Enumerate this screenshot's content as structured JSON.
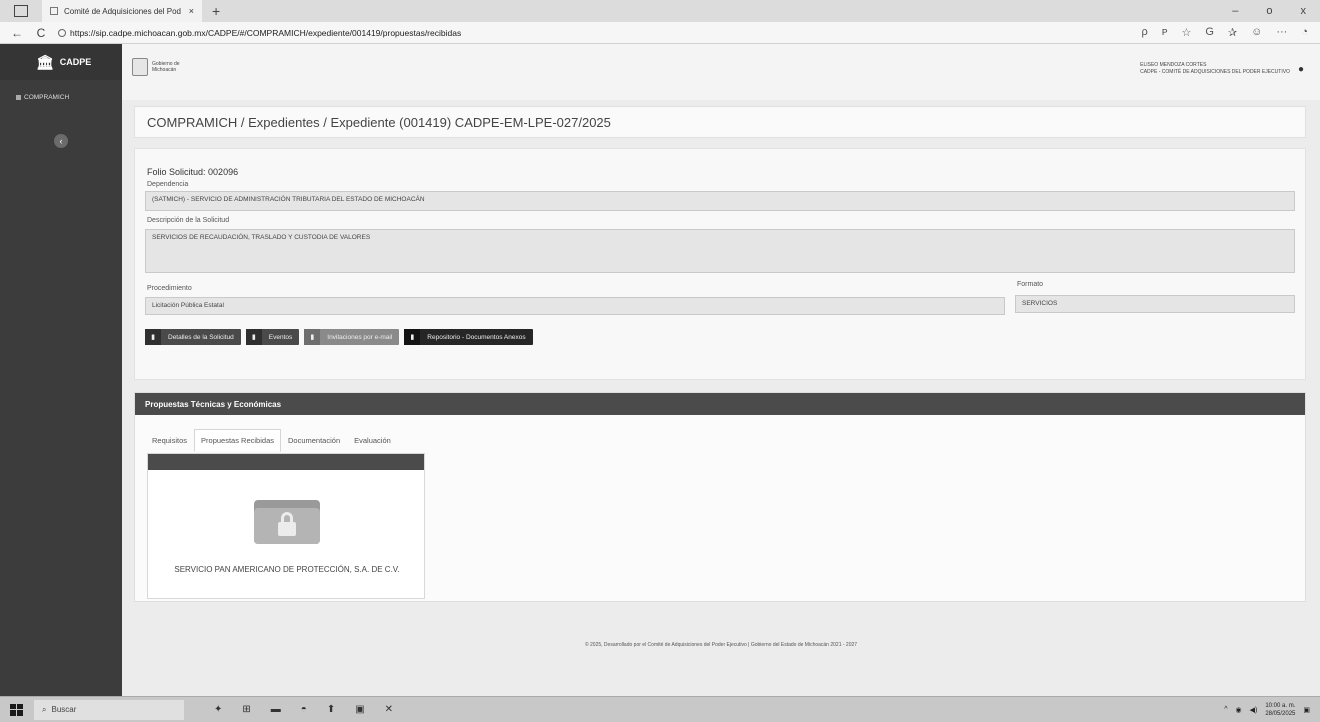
{
  "browser": {
    "tab_title": "Comité de Adquisiciones del Pod",
    "tab_close": "×",
    "new_tab": "+",
    "window_controls": [
      "–",
      "o",
      "x"
    ],
    "url": "https://sip.cadpe.michoacan.gob.mx/CADPE/#/COMPRAMICH/expediente/001419/propuestas/recibidas",
    "back": "←",
    "reload": "C",
    "tools": [
      "ρ",
      "ᴘ",
      "☆",
      "G",
      "✰",
      "☺",
      "···",
      "◔"
    ]
  },
  "sidebar": {
    "brand": "CADPE",
    "brand_icon": "temple-icon",
    "item": "COMPRAMICH",
    "collapse": "‹"
  },
  "header": {
    "gov_logo_text": "Gobierno de Michoacán",
    "user_name": "ELISEO MENDOZA CORTES",
    "user_org": "CADPE - COMITÉ DE ADQUISICIONES DEL PODER EJECUTIVO",
    "user_icon": "●"
  },
  "breadcrumb": "COMPRAMICH / Expedientes / Expediente (001419) CADPE-EM-LPE-027/2025",
  "solicitud": {
    "folio_label": "Folio Solicitud:",
    "folio_value": "002096",
    "dependencia_label": "Dependencia",
    "dependencia_value": "(SATMICH) - SERVICIO DE ADMINISTRACIÓN TRIBUTARIA DEL ESTADO DE MICHOACÁN",
    "descripcion_label": "Descripción de la Solicitud",
    "descripcion_value": "SERVICIOS DE RECAUDACIÓN, TRASLADO Y CUSTODIA DE VALORES",
    "procedimiento_label": "Procedimiento",
    "procedimiento_value": "Licitación Pública Estatal",
    "formato_label": "Formato",
    "formato_value": "SERVICIOS",
    "buttons": [
      {
        "icon": "▮",
        "label": "Detalles de la Solicitud"
      },
      {
        "icon": "▮",
        "label": "Eventos"
      },
      {
        "icon": "▮",
        "label": "Invitaciones por e-mail"
      },
      {
        "icon": "▮",
        "label": "Repositorio - Documentos Anexos"
      }
    ]
  },
  "proposals": {
    "title": "Propuestas Técnicas y Económicas",
    "tabs": [
      "Requisitos",
      "Propuestas Recibidas",
      "Documentación",
      "Evaluación"
    ],
    "card_title": "SERVICIO PAN AMERICANO DE PROTECCIÓN, S.A. DE C.V."
  },
  "footer": "© 2025, Desarrollado por el Comité de Adquisiciones del Poder Ejecutivo | Gobierno del Estado de Michoacán 2021 - 2027",
  "taskbar": {
    "search_label": "Buscar",
    "apps": [
      "✦",
      "⊞",
      "▬",
      "◓",
      "⬆",
      "▣",
      "✕"
    ],
    "tray_arrow": "^",
    "time": "10:00 a. m.",
    "date": "28/05/2025",
    "notif": "▣"
  }
}
